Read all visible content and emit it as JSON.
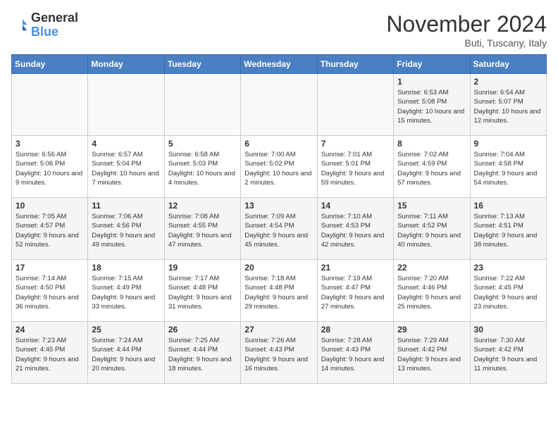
{
  "logo": {
    "line1": "General",
    "line2": "Blue"
  },
  "title": "November 2024",
  "subtitle": "Buti, Tuscany, Italy",
  "days_of_week": [
    "Sunday",
    "Monday",
    "Tuesday",
    "Wednesday",
    "Thursday",
    "Friday",
    "Saturday"
  ],
  "weeks": [
    [
      {
        "day": "",
        "info": ""
      },
      {
        "day": "",
        "info": ""
      },
      {
        "day": "",
        "info": ""
      },
      {
        "day": "",
        "info": ""
      },
      {
        "day": "",
        "info": ""
      },
      {
        "day": "1",
        "info": "Sunrise: 6:53 AM\nSunset: 5:08 PM\nDaylight: 10 hours and 15 minutes."
      },
      {
        "day": "2",
        "info": "Sunrise: 6:54 AM\nSunset: 5:07 PM\nDaylight: 10 hours and 12 minutes."
      }
    ],
    [
      {
        "day": "3",
        "info": "Sunrise: 6:56 AM\nSunset: 5:06 PM\nDaylight: 10 hours and 9 minutes."
      },
      {
        "day": "4",
        "info": "Sunrise: 6:57 AM\nSunset: 5:04 PM\nDaylight: 10 hours and 7 minutes."
      },
      {
        "day": "5",
        "info": "Sunrise: 6:58 AM\nSunset: 5:03 PM\nDaylight: 10 hours and 4 minutes."
      },
      {
        "day": "6",
        "info": "Sunrise: 7:00 AM\nSunset: 5:02 PM\nDaylight: 10 hours and 2 minutes."
      },
      {
        "day": "7",
        "info": "Sunrise: 7:01 AM\nSunset: 5:01 PM\nDaylight: 9 hours and 59 minutes."
      },
      {
        "day": "8",
        "info": "Sunrise: 7:02 AM\nSunset: 4:59 PM\nDaylight: 9 hours and 57 minutes."
      },
      {
        "day": "9",
        "info": "Sunrise: 7:04 AM\nSunset: 4:58 PM\nDaylight: 9 hours and 54 minutes."
      }
    ],
    [
      {
        "day": "10",
        "info": "Sunrise: 7:05 AM\nSunset: 4:57 PM\nDaylight: 9 hours and 52 minutes."
      },
      {
        "day": "11",
        "info": "Sunrise: 7:06 AM\nSunset: 4:56 PM\nDaylight: 9 hours and 49 minutes."
      },
      {
        "day": "12",
        "info": "Sunrise: 7:08 AM\nSunset: 4:55 PM\nDaylight: 9 hours and 47 minutes."
      },
      {
        "day": "13",
        "info": "Sunrise: 7:09 AM\nSunset: 4:54 PM\nDaylight: 9 hours and 45 minutes."
      },
      {
        "day": "14",
        "info": "Sunrise: 7:10 AM\nSunset: 4:53 PM\nDaylight: 9 hours and 42 minutes."
      },
      {
        "day": "15",
        "info": "Sunrise: 7:11 AM\nSunset: 4:52 PM\nDaylight: 9 hours and 40 minutes."
      },
      {
        "day": "16",
        "info": "Sunrise: 7:13 AM\nSunset: 4:51 PM\nDaylight: 9 hours and 38 minutes."
      }
    ],
    [
      {
        "day": "17",
        "info": "Sunrise: 7:14 AM\nSunset: 4:50 PM\nDaylight: 9 hours and 36 minutes."
      },
      {
        "day": "18",
        "info": "Sunrise: 7:15 AM\nSunset: 4:49 PM\nDaylight: 9 hours and 33 minutes."
      },
      {
        "day": "19",
        "info": "Sunrise: 7:17 AM\nSunset: 4:48 PM\nDaylight: 9 hours and 31 minutes."
      },
      {
        "day": "20",
        "info": "Sunrise: 7:18 AM\nSunset: 4:48 PM\nDaylight: 9 hours and 29 minutes."
      },
      {
        "day": "21",
        "info": "Sunrise: 7:19 AM\nSunset: 4:47 PM\nDaylight: 9 hours and 27 minutes."
      },
      {
        "day": "22",
        "info": "Sunrise: 7:20 AM\nSunset: 4:46 PM\nDaylight: 9 hours and 25 minutes."
      },
      {
        "day": "23",
        "info": "Sunrise: 7:22 AM\nSunset: 4:45 PM\nDaylight: 9 hours and 23 minutes."
      }
    ],
    [
      {
        "day": "24",
        "info": "Sunrise: 7:23 AM\nSunset: 4:45 PM\nDaylight: 9 hours and 21 minutes."
      },
      {
        "day": "25",
        "info": "Sunrise: 7:24 AM\nSunset: 4:44 PM\nDaylight: 9 hours and 20 minutes."
      },
      {
        "day": "26",
        "info": "Sunrise: 7:25 AM\nSunset: 4:44 PM\nDaylight: 9 hours and 18 minutes."
      },
      {
        "day": "27",
        "info": "Sunrise: 7:26 AM\nSunset: 4:43 PM\nDaylight: 9 hours and 16 minutes."
      },
      {
        "day": "28",
        "info": "Sunrise: 7:28 AM\nSunset: 4:43 PM\nDaylight: 9 hours and 14 minutes."
      },
      {
        "day": "29",
        "info": "Sunrise: 7:29 AM\nSunset: 4:42 PM\nDaylight: 9 hours and 13 minutes."
      },
      {
        "day": "30",
        "info": "Sunrise: 7:30 AM\nSunset: 4:42 PM\nDaylight: 9 hours and 11 minutes."
      }
    ]
  ]
}
